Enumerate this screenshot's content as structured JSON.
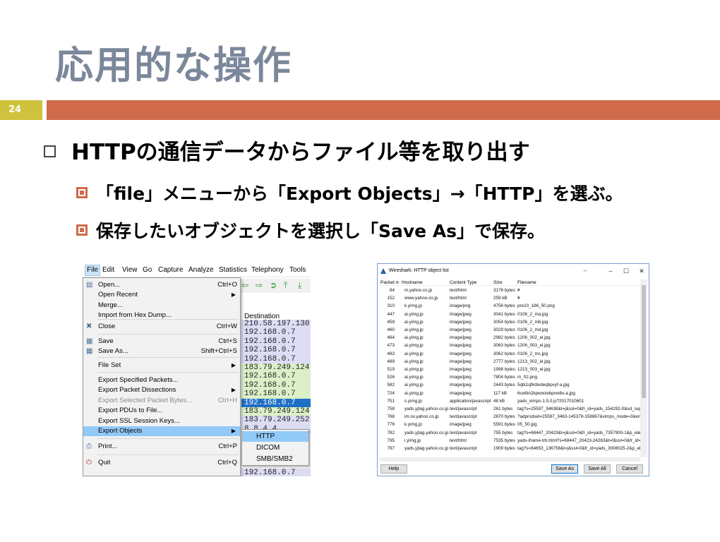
{
  "slide": {
    "title": "応用的な操作",
    "page_number": "24",
    "bullet1": "HTTPの通信データからファイル等を取り出す",
    "bullet2": "「file」メニューから「Export Objects」→「HTTP」を選ぶ。",
    "bullet3": "保存したいオブジェクトを選択し「Save As」で保存。",
    "colors": {
      "title": "#7b879a",
      "accent_bar": "#cf6a4a",
      "page_box": "#cfc23c"
    }
  },
  "wireshark_main": {
    "menubar": [
      "File",
      "Edit",
      "View",
      "Go",
      "Capture",
      "Analyze",
      "Statistics",
      "Telephony",
      "Tools"
    ],
    "column_header": "Destination",
    "destinations": [
      "210.58.197.130",
      "192.168.0.7",
      "192.168.0.7",
      "192.168.0.7",
      "192.168.0.7",
      "183.79.249.124",
      "192.168.0.7",
      "192.168.0.7",
      "192.168.0.7",
      "192.168.0.7",
      "183.79.249.124",
      "183.79.249.252",
      "8.8.4.4",
      "",
      "",
      "",
      "",
      "192.168.0.7"
    ],
    "file_menu": [
      {
        "label": "Open...",
        "shortcut": "Ctrl+O",
        "icon": "folder-icon"
      },
      {
        "label": "Open Recent",
        "submenu": true
      },
      {
        "label": "Merge..."
      },
      {
        "label": "Import from Hex Dump..."
      },
      {
        "label": "Close",
        "shortcut": "Ctrl+W",
        "icon": "close-icon"
      },
      {
        "label": "Save",
        "shortcut": "Ctrl+S",
        "icon": "save-icon"
      },
      {
        "label": "Save As...",
        "shortcut": "Shift+Ctrl+S",
        "icon": "save-as-icon"
      },
      {
        "label": "File Set",
        "submenu": true
      },
      {
        "label": "Export Specified Packets..."
      },
      {
        "label": "Export Packet Dissections",
        "submenu": true
      },
      {
        "label": "Export Selected Packet Bytes...",
        "shortcut": "Ctrl+H",
        "disabled": true
      },
      {
        "label": "Export PDUs to File..."
      },
      {
        "label": "Export SSL Session Keys..."
      },
      {
        "label": "Export Objects",
        "submenu": true,
        "highlighted": true
      },
      {
        "label": "Print...",
        "shortcut": "Ctrl+P",
        "icon": "print-icon"
      },
      {
        "label": "Quit",
        "shortcut": "Ctrl+Q",
        "icon": "quit-icon"
      }
    ],
    "export_objects_submenu": [
      "HTTP",
      "DICOM",
      "SMB/SMB2"
    ]
  },
  "http_object_list": {
    "title": "Wireshark: HTTP object list",
    "columns": [
      "Packet num",
      "Hostname",
      "Content Type",
      "Size",
      "Filename"
    ],
    "rows": [
      [
        "84",
        "m.yahoo.co.jp",
        "text/html",
        "3176 bytes",
        "¥"
      ],
      [
        "152",
        "www.yahoo.co.jp",
        "text/html",
        "259 kB",
        "¥"
      ],
      [
        "310",
        "k.yimg.jp",
        "image/png",
        "4756 bytes",
        "pre10_186_50.png"
      ],
      [
        "447",
        "ai.yimg.jp",
        "image/jpeg",
        "3041 bytes",
        "0106_2_ma.jpg"
      ],
      [
        "459",
        "ai.yimg.jp",
        "image/jpeg",
        "3054 bytes",
        "0106_2_mb.jpg"
      ],
      [
        "460",
        "ai.yimg.jp",
        "image/jpeg",
        "3029 bytes",
        "0106_2_md.jpg"
      ],
      [
        "464",
        "ai.yimg.jp",
        "image/jpeg",
        "2982 bytes",
        "1206_002_el.jpg"
      ],
      [
        "473",
        "ai.yimg.jp",
        "image/jpeg",
        "3063 bytes",
        "1206_003_el.jpg"
      ],
      [
        "483",
        "ai.yimg.jp",
        "image/jpeg",
        "3062 bytes",
        "0106_2_mc.jpg"
      ],
      [
        "489",
        "ai.yimg.jp",
        "image/jpeg",
        "2777 bytes",
        "1213_002_el.jpg"
      ],
      [
        "519",
        "ai.yimg.jp",
        "image/jpeg",
        "1998 bytes",
        "1213_003_el.jpg"
      ],
      [
        "526",
        "ai.yimg.jp",
        "image/jpeg",
        "7804 bytes",
        "m_02.png"
      ],
      [
        "582",
        "ai.yimg.jp",
        "image/jpeg",
        "2443 bytes",
        "5qtk1qfirdivdeqbpvyf-a.jpg"
      ],
      [
        "724",
        "ai.yimg.jp",
        "image/jpeg",
        "117 kB",
        "6ce6tn2kpwwzebpvw8x-a.jpg"
      ],
      [
        "751",
        "s.yimg.jp",
        "application/javascript",
        "48 kB",
        "yads_vimps-1.5.0.js?2017010601"
      ],
      [
        "758",
        "yads.yjtag.yahoo.co.jp",
        "text/javascript",
        "261 bytes",
        "tag?s=25597_34638&t=j&ssl=0&fr_id=yads_154292-0&xd_support=1"
      ],
      [
        "768",
        "im.ov.yahoo.co.jp",
        "text/javascript",
        "2870 bytes",
        "?adprodset=25597_3463-145378-158867&vimps_mode=3&enc=UTF-8"
      ],
      [
        "776",
        "k.yimg.jp",
        "image/jpeg",
        "5591 bytes",
        "05_50.jpg"
      ],
      [
        "782",
        "yads.yjtag.yahoo.co.jp",
        "text/javascript",
        "755 bytes",
        "tag?s=68447_20423&t=j&ssl=0&fr_id=yads_7357900-1&p_elem=yads"
      ],
      [
        "795",
        "i.yimg.jp",
        "text/html",
        "7535 bytes",
        "yads-iframe-trb.html?s=68447_20423-24263&t=f&ssl=0&fr_id=yads"
      ],
      [
        "797",
        "yads.yjtag.yahoo.co.jp",
        "text/javascript",
        "1909 bytes",
        "tag?s=84653_136756&t=j&ssl=0&fr_id=yads_3008025-2&p_elem=yads"
      ]
    ],
    "buttons": {
      "help": "Help",
      "save_as": "Save As",
      "save_all": "Save All",
      "cancel": "Cancel"
    }
  }
}
